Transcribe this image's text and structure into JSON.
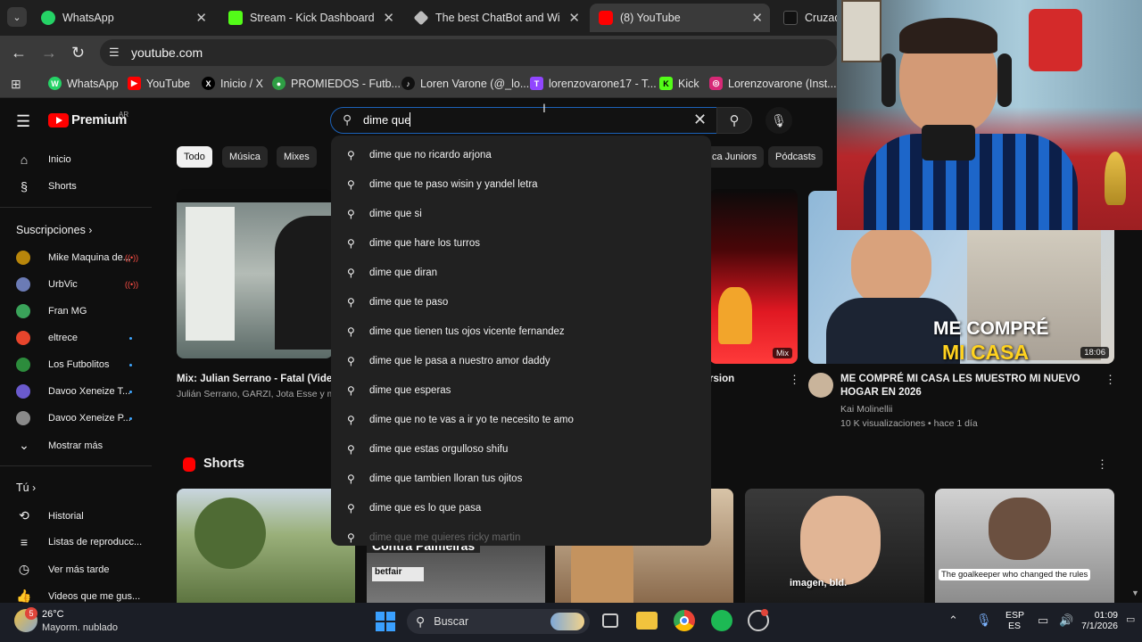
{
  "tabs": [
    {
      "title": "WhatsApp",
      "color": "#25d366",
      "icon": "whatsapp-icon"
    },
    {
      "title": "Stream - Kick Dashboard",
      "color": "#53fc18",
      "icon": "kick-icon"
    },
    {
      "title": "The best ChatBot and Widge",
      "color": "#e3e3e3",
      "icon": "bot-icon"
    },
    {
      "title": "(8) YouTube",
      "color": "#ff0000",
      "icon": "youtube-icon"
    },
    {
      "title": "Cruzado",
      "color": "#e3e3e3",
      "icon": "tiktok-icon"
    }
  ],
  "address": {
    "url": "youtube.com"
  },
  "bookmarks": [
    {
      "label": "WhatsApp",
      "color": "#25d366",
      "glyph": "W"
    },
    {
      "label": "YouTube",
      "color": "#ff0000",
      "glyph": "▶"
    },
    {
      "label": "Inicio / X",
      "color": "#000000",
      "glyph": "X"
    },
    {
      "label": "PROMIEDOS - Futb...",
      "color": "#2e9e44",
      "glyph": "●"
    },
    {
      "label": "Loren Varone (@_lo...",
      "color": "#111111",
      "glyph": "♪"
    },
    {
      "label": "lorenzovarone17 - T...",
      "color": "#9146ff",
      "glyph": "T"
    },
    {
      "label": "Kick",
      "color": "#53fc18",
      "glyph": "K"
    },
    {
      "label": "Lorenzovarone (Inst...",
      "color": "#d62976",
      "glyph": "◎"
    }
  ],
  "youtube": {
    "logo": "Premium",
    "region": "AR",
    "search_value": "dime que",
    "sidebar": {
      "main": [
        {
          "label": "Inicio",
          "icon": "home-icon"
        },
        {
          "label": "Shorts",
          "icon": "shorts-icon"
        }
      ],
      "subs_header": "Suscripciones",
      "subs": [
        {
          "label": "Mike Maquina de...",
          "color": "#b8860b",
          "live": true
        },
        {
          "label": "UrbVic",
          "color": "#6b7bb5",
          "live": true
        },
        {
          "label": "Fran MG",
          "color": "#3aa35a",
          "live": false
        },
        {
          "label": "eltrece",
          "color": "#e8452c",
          "live": false,
          "dot": true
        },
        {
          "label": "Los Futbolitos",
          "color": "#2c8c3c",
          "live": false,
          "dot": true
        },
        {
          "label": "Davoo Xeneize T...",
          "color": "#6a5acd",
          "live": false,
          "dot": true
        },
        {
          "label": "Davoo Xeneize P...",
          "color": "#8a8a8a",
          "live": false,
          "dot": true
        }
      ],
      "show_more": "Mostrar más",
      "you_header": "Tú",
      "you": [
        {
          "label": "Historial",
          "icon": "history-icon"
        },
        {
          "label": "Listas de reproducc...",
          "icon": "playlists-icon"
        },
        {
          "label": "Ver más tarde",
          "icon": "clock-icon"
        },
        {
          "label": "Videos que me gus...",
          "icon": "thumbs-up-icon"
        }
      ]
    },
    "chips": [
      "Todo",
      "Música",
      "Mixes",
      "ca Juniors",
      "Pódcasts"
    ],
    "videos": [
      {
        "title": "Mix: Julian Serrano - Fatal (Vide",
        "meta": "Julián Serrano, GARZI, Jota Esse y m"
      },
      {
        "title": "rsion",
        "badge": "Mix"
      },
      {
        "title": "ME COMPRÉ MI CASA LES MUESTRO MI NUEVO HOGAR EN 2026",
        "channel": "Kai Molinellii",
        "stats": "10 K visualizaciones • hace 1 día",
        "duration": "18:06",
        "thumb_line1": "ME COMPRÉ",
        "thumb_line2": "MI CASA"
      }
    ],
    "shorts_header": "Shorts",
    "shorts": [
      {
        "caption": ""
      },
      {
        "caption": "Contra Palmeiras"
      },
      {
        "caption": ""
      },
      {
        "caption": "imagen, bld."
      },
      {
        "caption": "The goalkeeper who changed the rules"
      }
    ],
    "suggestions": [
      "dime que no ricardo arjona",
      "dime que te paso wisin y yandel letra",
      "dime que si",
      "dime que hare los turros",
      "dime que diran",
      "dime que te paso",
      "dime que tienen tus ojos vicente fernandez",
      "dime que le pasa a nuestro amor daddy",
      "dime que esperas",
      "dime que no te vas a ir yo te necesito te amo",
      "dime que estas orgulloso shifu",
      "dime que tambien lloran tus ojitos",
      "dime que es lo que pasa",
      "dime que me quieres ricky martin"
    ]
  },
  "taskbar": {
    "weather_temp": "26°C",
    "weather_desc": "Mayorm. nublado",
    "weather_badge": "5",
    "search_label": "Buscar",
    "lang1": "ESP",
    "lang2": "ES",
    "time": "01:09",
    "date": "7/1/2026"
  }
}
